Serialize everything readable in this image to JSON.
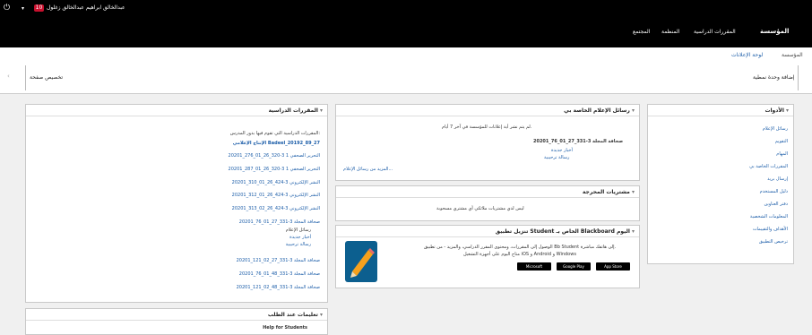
{
  "topbar": {
    "power_icon": "power-icon",
    "menu_glyph": "▾",
    "badge": "10",
    "user": "عبدالخالق ابراهيم عبدالخالق زغلول"
  },
  "nav": {
    "tabs": [
      "المؤسسة",
      "المقررات الدراسية",
      "المنظمة",
      "المجتمع"
    ]
  },
  "subtabs": {
    "current": "المؤسسة",
    "link": "لوحة الإعلانات"
  },
  "actions": {
    "add_module": "إضافة وحدة نمطية",
    "customize": "تخصيص صفحة"
  },
  "tools": {
    "title": "الأدوات",
    "items": [
      "رسائل الإعلام",
      "التقويم",
      "المهام",
      "المقررات الخاصة بي",
      "إرسال بريد",
      "دليل المستخدم",
      "دفتر العناوين",
      "المعلومات الشخصية",
      "الأهداف والتقييمات",
      "ترخيص التطبيق"
    ]
  },
  "announcements": {
    "title": "رسائل الإعلام الخاصة بي",
    "empty": "لم يتم نشر أية إعلانات للمؤسسة في آخر 7 أيام.",
    "course_line": "صحافة المجلة 3-331_27_01_76_20201",
    "sub_link_1": "أخبار جديدة",
    "sub_link_2": "رسالة ترحيبية",
    "more": "المزيد من رسائل الإعلام..."
  },
  "calendar": {
    "title": "مشتريات المحرجة",
    "empty": "ليس لدي مشتريات ملائكي أي مشتري مسحوبة"
  },
  "app_promo": {
    "title": "تنزيل تطبيق Student الخاص بـ Blackboard اليوم",
    "text_1": "الوصول إلى المقررات، ومحتوى المقرر الدراسي، والمزيد - من تطبيق Bb Student إلى هاتفك مباشرة.",
    "text_2": "متاح اليوم على أجهزة التشغيل iOS و Android و Windows",
    "store_1": "Microsoft",
    "store_2": "Google Play",
    "store_3": "App Store"
  },
  "courses": {
    "title": "المقررات الدراسية",
    "intro": "المقررات الدراسية التي تقوم فيها بدور المدرس:",
    "items": [
      {
        "text": "الإنتاج الإعلامي Badeel_20192_89_27",
        "bold": "Badeel_20192_89_27"
      },
      {
        "text": "التحرير الصحفي 1 3-320_26_01_276_20201"
      },
      {
        "text": "التحرير الصحفي 1 3-320_26_01_287_20201"
      },
      {
        "text": "النشر الإلكتروني 3-424_26_01_310_20201"
      },
      {
        "text": "النشر الإلكتروني 3-424_26_01_312_20201"
      },
      {
        "text": "النشر الإلكتروني 3-424_26_02_313_20201"
      },
      {
        "text": "صحافة المجلة 3-331_27_01_76_20201"
      },
      {
        "text": "رسائل الإعلام"
      },
      {
        "text": "أخبار جديدة"
      },
      {
        "text": "رسالة ترحيبية"
      },
      {
        "text": "صحافة المجلة 3-331_27_02_121_20201"
      },
      {
        "text": "صحافة المجلة 3-331_48_01_76_20201"
      },
      {
        "text": "صحافة المجلة 3-331_48_02_121_20201"
      }
    ]
  },
  "on_demand": {
    "title": "تعليمات عند الطلب",
    "help": "Help for Students"
  },
  "colors": {
    "topbar": "#000000",
    "link": "#1a5ca8",
    "badge": "#c8102e"
  }
}
